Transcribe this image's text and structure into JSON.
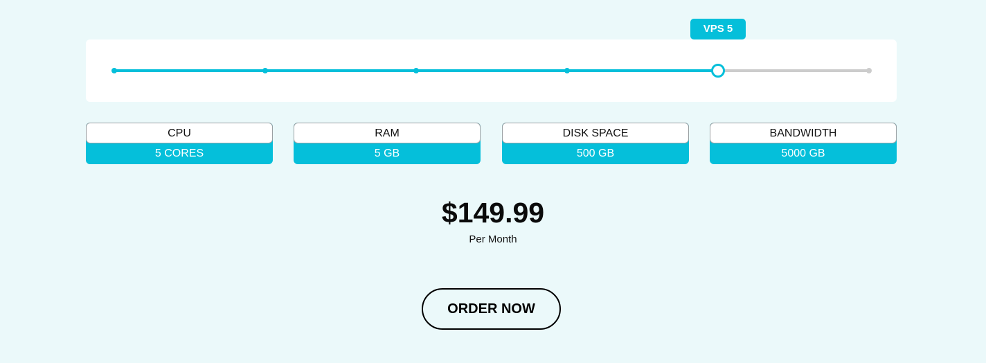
{
  "slider": {
    "steps": 6,
    "selected_index": 4,
    "tooltip_label": "VPS 5"
  },
  "specs": [
    {
      "label": "CPU",
      "value": "5 CORES"
    },
    {
      "label": "RAM",
      "value": "5 GB"
    },
    {
      "label": "DISK SPACE",
      "value": "500 GB"
    },
    {
      "label": "BANDWIDTH",
      "value": "5000 GB"
    }
  ],
  "pricing": {
    "price": "$149.99",
    "period": "Per Month"
  },
  "cta": {
    "label": "ORDER NOW"
  },
  "colors": {
    "accent": "#05bfda",
    "background": "#ebf9fa",
    "track_inactive": "#cccccc"
  }
}
